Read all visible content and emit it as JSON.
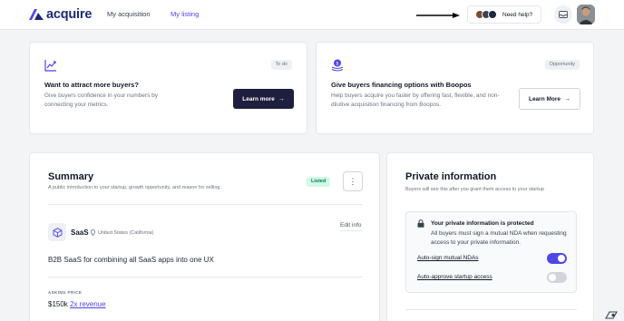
{
  "header": {
    "brand": "acquire",
    "nav": [
      {
        "label": "My acquisition",
        "active": false
      },
      {
        "label": "My listing",
        "active": true
      }
    ],
    "help_label": "Need help?"
  },
  "promos": [
    {
      "badge": "To do",
      "title": "Want to attract more buyers?",
      "description": "Give buyers confidence in your numbers by connecting your metrics.",
      "button": "Learn more"
    },
    {
      "badge": "Opportunity",
      "title": "Give buyers financing options with Boopos",
      "description": "Help buyers acquire you faster by offering fast, flexible, and non-dilutive acquisition financing from Boopos.",
      "button": "Learn More"
    }
  ],
  "summary": {
    "title": "Summary",
    "description": "A public introduction to your startup, growth opportunity, and reason for selling.",
    "status": "Listed",
    "category": "SaaS",
    "location": "United States (California)",
    "edit_label": "Edit info",
    "tagline": "B2B SaaS for combining all SaaS apps into one UX",
    "asking_label": "ASKING PRICE",
    "asking_price": "$150k",
    "revenue_multiple": "2x revenue"
  },
  "private_info": {
    "title": "Private information",
    "description": "Buyers will see this after you grant them access to your startup",
    "protected_title": "Your private information is protected",
    "protected_desc": "All buyers must sign a mutual NDA when requesting access to your private information.",
    "toggles": [
      {
        "label": "Auto-sign mutual NDAs",
        "on": true
      },
      {
        "label": "Auto-approve startup access",
        "on": false
      }
    ]
  },
  "colors": {
    "accent": "#4f46e5",
    "brand_navy": "#1e2a78",
    "dark_button": "#1e1e3f",
    "listed_bg": "#d1fae5"
  }
}
